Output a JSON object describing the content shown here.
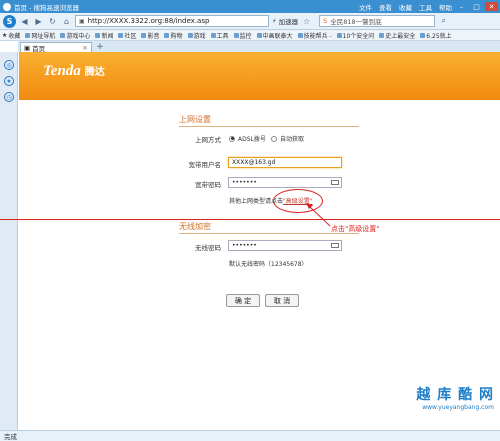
{
  "window": {
    "title": "首页 - 搜狗高速浏览器",
    "menus": [
      "文件",
      "查看",
      "收藏",
      "工具",
      "帮助"
    ],
    "controls": {
      "minimize": "–",
      "maximize": "□",
      "close": "✕"
    }
  },
  "toolbar": {
    "address": "http://XXXX.3322.org:88/index.asp",
    "mode_label": "加速器",
    "search_placeholder": "全民818一瞥到底",
    "logo_glyph": "S"
  },
  "bookmarks": {
    "items": [
      "收藏",
      "网址导航",
      "游戏中心",
      "新闻",
      "社区",
      "影音",
      "购物",
      "游戏",
      "工具",
      "监控",
      "中画联泰大",
      "技能帮兵 -",
      "10个安全问",
      "史上最安全",
      "6.25就上"
    ]
  },
  "tabs": {
    "active_label": "首页",
    "close_glyph": "×",
    "add_glyph": "+"
  },
  "banner": {
    "brand_en": "Tenda",
    "brand_cn": "腾达"
  },
  "internet": {
    "section_title": "上网设置",
    "mode_label": "上网方式",
    "option_adsl": "ADSL拨号",
    "option_auto": "自动获取",
    "user_label": "宽带用户名",
    "user_value": "XXXX@163.gd",
    "pass_label": "宽带密码",
    "pass_value": "•••••••",
    "other_note": "其他上网类型请点击",
    "advanced_link": "\"高级设置\""
  },
  "wireless": {
    "section_title": "无线加密",
    "pass_label": "无线密码",
    "pass_value": "•••••••",
    "default_note": "默认无线密码（12345678）"
  },
  "buttons": {
    "confirm": "确 定",
    "cancel": "取 消"
  },
  "annotation": {
    "text": "点击\"高级设置\""
  },
  "status": {
    "text": "完成"
  },
  "watermark": {
    "title": "越 库 酷 网",
    "url": "www.yueyangbang.com"
  },
  "colors": {
    "accent_orange": "#f28a10",
    "annotation_red": "#dd2222",
    "browser_blue": "#3a8fd0"
  }
}
